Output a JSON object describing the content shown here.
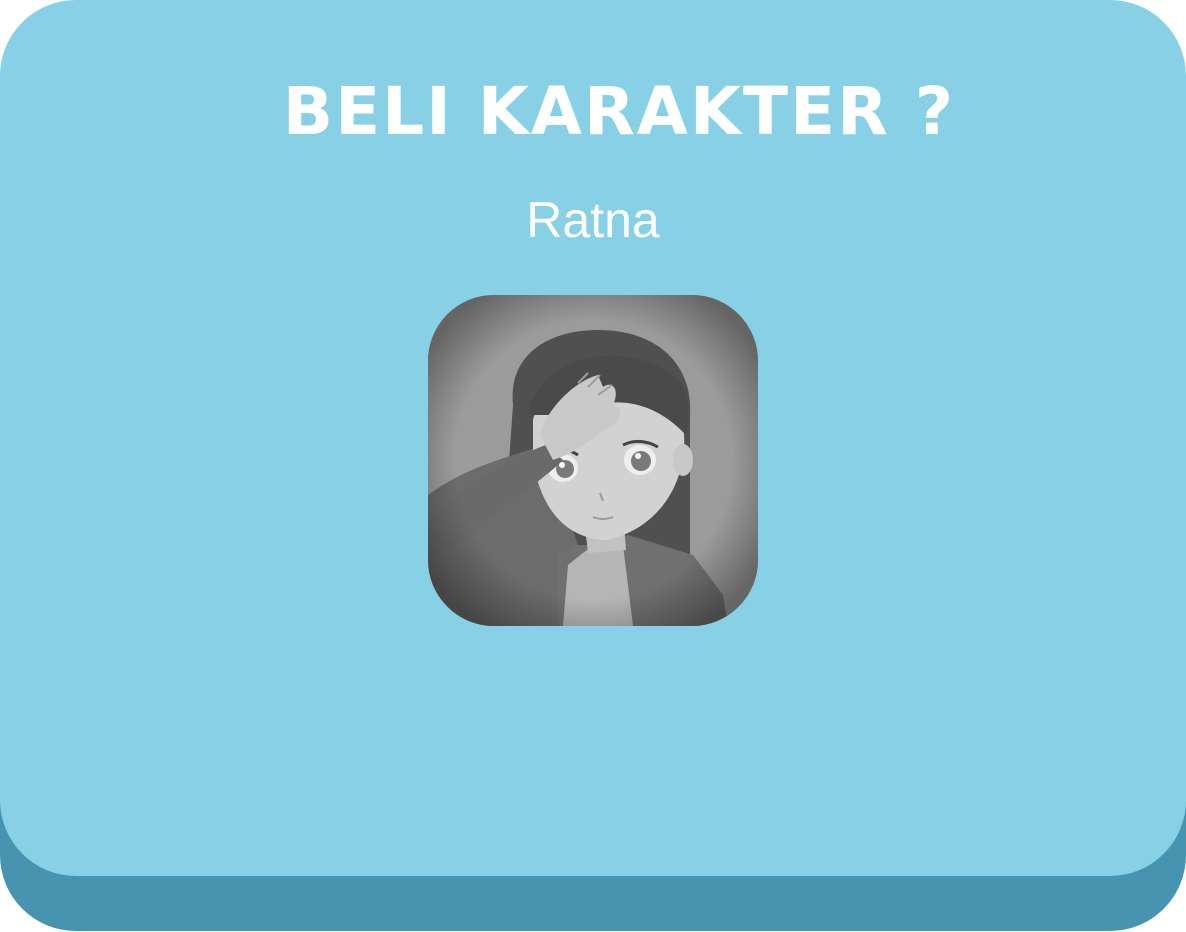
{
  "dialog": {
    "title": "BELI KARAKTER ?",
    "character_name": "Ratna",
    "portrait_icon": "character-portrait",
    "colors": {
      "panel": "#87d0e5",
      "panel_shadow": "#4694b0",
      "text": "#ffffff",
      "portrait_bg": "#9a9a9a"
    }
  }
}
